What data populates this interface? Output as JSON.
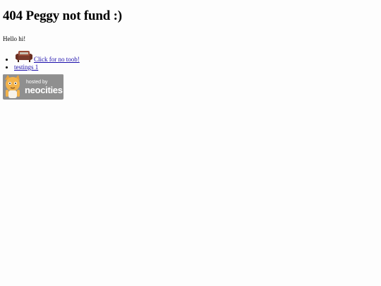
{
  "page": {
    "title": "404 Peggy not fund :)",
    "greeting": "Hello hi!"
  },
  "links": [
    {
      "label": "Click for no toob!",
      "icon": "couch-icon"
    },
    {
      "label": "testings 1"
    }
  ],
  "badge": {
    "line1": "hosted by",
    "line2": "neocities",
    "icon": "neocities-cat-icon",
    "bg_color": "#8f8f8f"
  }
}
